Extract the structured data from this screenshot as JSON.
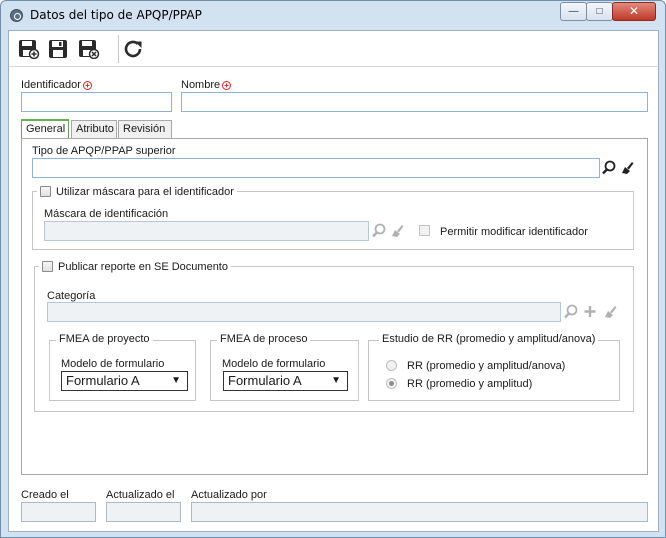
{
  "window": {
    "title": "Datos del tipo de APQP/PPAP",
    "controls": {
      "minimize": "—",
      "maximize": "□",
      "close": "✕"
    }
  },
  "toolbar": {
    "buttons": [
      {
        "name": "save-new-button",
        "icon": "save-plus-icon"
      },
      {
        "name": "save-button",
        "icon": "save-icon"
      },
      {
        "name": "save-close-button",
        "icon": "save-close-icon"
      },
      {
        "name": "refresh-button",
        "icon": "refresh-icon"
      }
    ]
  },
  "fields": {
    "identificador_label": "Identificador",
    "identificador_value": "",
    "nombre_label": "Nombre",
    "nombre_value": ""
  },
  "tabs": [
    "General",
    "Atributo",
    "Revisión"
  ],
  "general": {
    "tipo_superior_label": "Tipo de APQP/PPAP superior",
    "tipo_superior_value": "",
    "mascara_group_label": "Utilizar máscara para el identificador",
    "mascara_checked": false,
    "mascara_label": "Máscara de identificación",
    "mascara_value": "",
    "permitir_label": "Permitir modificar identificador",
    "permitir_checked": false,
    "publicar_group_label": "Publicar reporte en SE Documento",
    "publicar_checked": false,
    "categoria_label": "Categoría",
    "categoria_value": "",
    "fmea_proyecto": {
      "title": "FMEA de proyecto",
      "modelo_label": "Modelo de formulario",
      "selected": "Formulario A"
    },
    "fmea_proceso": {
      "title": "FMEA de proceso",
      "modelo_label": "Modelo de formulario",
      "selected": "Formulario A"
    },
    "estudio_rr": {
      "title": "Estudio de RR (promedio y amplitud/anova)",
      "options": [
        "RR (promedio y amplitud/anova)",
        "RR (promedio y amplitud)"
      ],
      "selected_index": 1
    }
  },
  "footer": {
    "creado_label": "Creado el",
    "creado_value": "",
    "actualizado_label": "Actualizado el",
    "actualizado_value": "",
    "actualizado_por_label": "Actualizado por",
    "actualizado_por_value": ""
  },
  "colors": {
    "required": "#dd2222",
    "tab_accent": "#68b04c",
    "input_border": "#8fb1d3"
  }
}
